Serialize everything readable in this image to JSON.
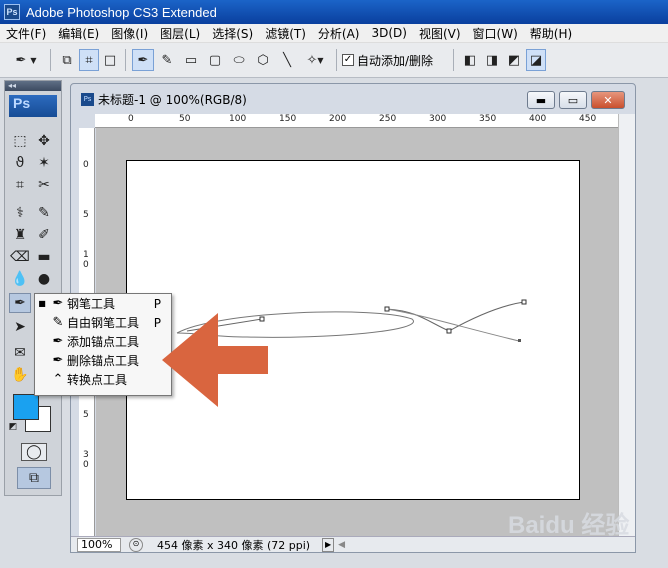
{
  "app": {
    "title": "Adobe Photoshop CS3 Extended",
    "logo": "Ps"
  },
  "menu": [
    "文件(F)",
    "编辑(E)",
    "图像(I)",
    "图层(L)",
    "选择(S)",
    "滤镜(T)",
    "分析(A)",
    "3D(D)",
    "视图(V)",
    "窗口(W)",
    "帮助(H)"
  ],
  "options": {
    "auto_add_delete": "自动添加/删除",
    "checked": "✓"
  },
  "toolbox": {
    "header": "◂◂",
    "logo": "Ps"
  },
  "document": {
    "title": "未标题-1 @ 100%(RGB/8)",
    "ruler_top": [
      "0",
      "50",
      "100",
      "150",
      "200",
      "250",
      "300",
      "350",
      "400",
      "450"
    ],
    "ruler_left": [
      "0",
      "5",
      "1",
      "0",
      "5",
      "2",
      "0",
      "5",
      "3",
      "0"
    ],
    "zoom": "100%",
    "status": "454 像素 x 340 像素 (72 ppi)"
  },
  "flyout": {
    "items": [
      {
        "label": "钢笔工具",
        "shortcut": "P",
        "bullet": "■"
      },
      {
        "label": "自由钢笔工具",
        "shortcut": "P",
        "bullet": ""
      },
      {
        "label": "添加锚点工具",
        "shortcut": "",
        "bullet": ""
      },
      {
        "label": "删除锚点工具",
        "shortcut": "",
        "bullet": ""
      },
      {
        "label": "转换点工具",
        "shortcut": "",
        "bullet": ""
      }
    ]
  },
  "colors": {
    "foreground": "#1aa1f0",
    "background": "#ffffff",
    "arrow": "#d9653f",
    "titlebar": "#0a3f9e"
  },
  "watermark": "Baidu 经验"
}
